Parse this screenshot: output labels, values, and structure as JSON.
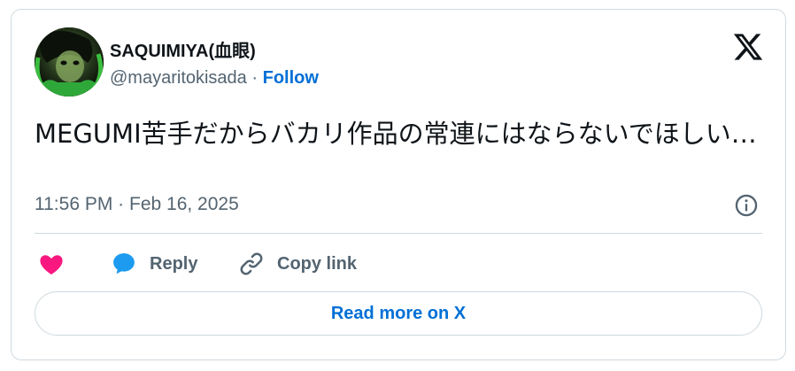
{
  "author": {
    "display_name": "SAQUIMIYA(血眼)",
    "handle": "@mayaritokisada",
    "separator": "·",
    "follow_label": "Follow"
  },
  "tweet": {
    "text": "MEGUMI苦手だからバカリ作品の常連にはならないでほしい…",
    "timestamp": "11:56 PM · Feb 16, 2025"
  },
  "actions": {
    "reply_label": "Reply",
    "copy_link_label": "Copy link"
  },
  "footer": {
    "read_more_label": "Read more on X"
  },
  "icons": {
    "logo": "x-logo-icon",
    "info": "info-icon",
    "like": "heart-icon",
    "reply": "speech-bubble-icon",
    "copy": "link-icon"
  },
  "colors": {
    "accent": "#006fd6",
    "heart": "#f91880",
    "reply_bubble": "#1d9bf0",
    "muted": "#536471",
    "border": "#cfd9de",
    "text": "#0f1419"
  }
}
